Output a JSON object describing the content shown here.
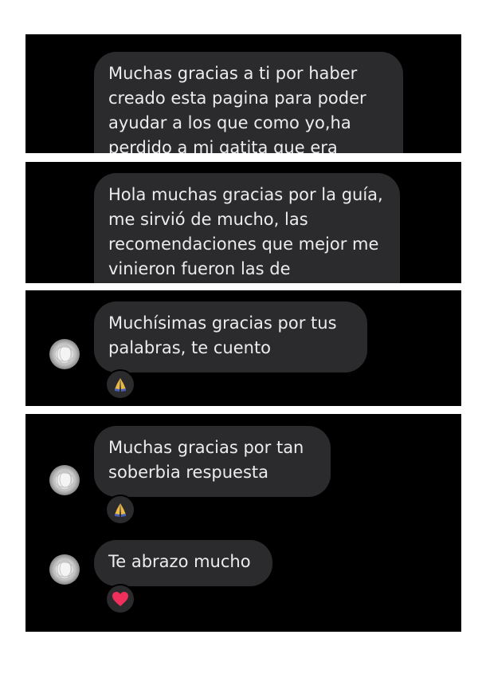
{
  "panels": [
    {
      "message": "Muchas gracias a ti por haber creado esta pagina para poder ayudar a los que como yo,ha perdido a mi gatita que era"
    },
    {
      "message": "Hola muchas gracias por la guía, me sirvió de mucho, las recomendaciones que mejor me vinieron fueron las de"
    },
    {
      "message": "Muchísimas gracias por tus palabras, te cuento",
      "reaction": "folded-hands-icon"
    },
    {
      "messages": [
        {
          "text": "Muchas gracias por tan soberbia respuesta",
          "reaction": "folded-hands-icon"
        },
        {
          "text": "Te abrazo mucho",
          "reaction": "red-heart-icon"
        }
      ]
    }
  ],
  "colors": {
    "panel_bg": "#000000",
    "bubble_bg": "#2b2b2d",
    "text": "#ececec",
    "heart": "#f0305a",
    "hands": "#4a5fb5"
  }
}
